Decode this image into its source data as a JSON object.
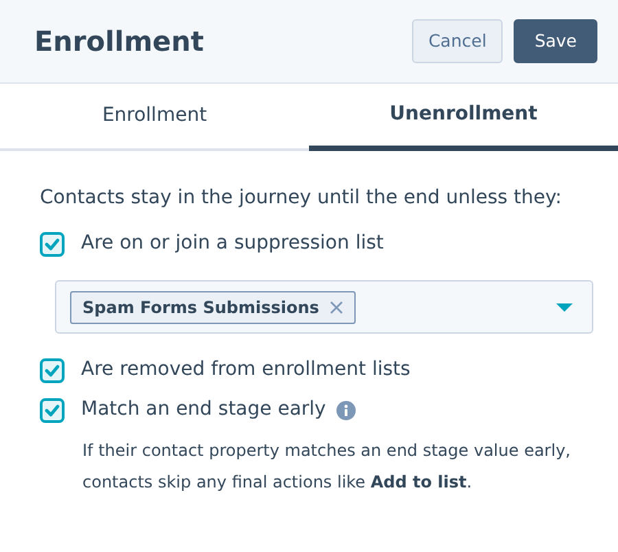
{
  "header": {
    "title": "Enrollment",
    "buttons": [
      {
        "label": "Cancel",
        "kind": "secondary"
      },
      {
        "label": "Save",
        "kind": "primary"
      }
    ]
  },
  "tabs": [
    {
      "label": "Enrollment",
      "selected": false
    },
    {
      "label": "Unenrollment",
      "selected": true
    }
  ],
  "intro": "Contacts stay in the journey until the end unless they:",
  "conditions": [
    {
      "label": "Are on or join a suppression list",
      "checked": true,
      "select": {
        "tags": [
          "Spam Forms Submissions"
        ]
      }
    },
    {
      "label": "Are removed from enrollment lists",
      "checked": true
    },
    {
      "label": "Match an end stage early",
      "checked": true,
      "info": true,
      "description": "If their contact property matches an end stage value early, contacts skip any final actions like **Add to list**."
    }
  ]
}
